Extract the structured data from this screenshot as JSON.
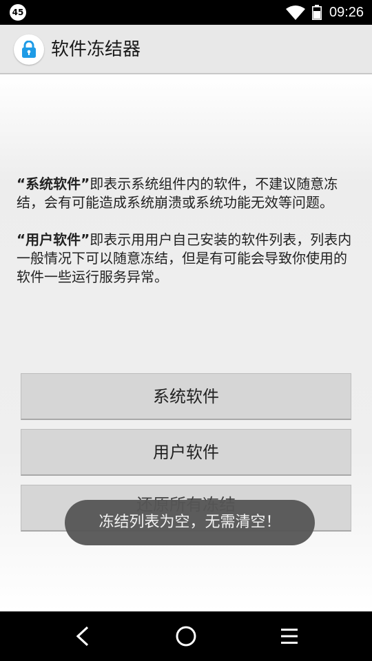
{
  "status_bar": {
    "notification_count": "45",
    "time": "09:26",
    "icons": [
      "wifi-icon",
      "battery-icon"
    ]
  },
  "action_bar": {
    "title": "软件冻结器",
    "icon": "lock-icon",
    "accent_color": "#1e9be6"
  },
  "content": {
    "system_desc": {
      "bold": "“系统软件”",
      "text": "即表示系统组件内的软件，不建议随意冻结，会有可能造成系统崩溃或系统功能无效等问题。"
    },
    "user_desc": {
      "bold": "“用户软件”",
      "text": "即表示用用户自己安装的软件列表，列表内一般情况下可以随意冻结，但是有可能会导致你使用的软件一些运行服务异常。"
    },
    "buttons": {
      "system": "系统软件",
      "user": "用户软件",
      "restore": "还原所有冻结"
    }
  },
  "toast": {
    "message": "冻结列表为空，无需清空！"
  },
  "nav_bar": {
    "icons": [
      "back-icon",
      "home-icon",
      "menu-icon"
    ]
  }
}
